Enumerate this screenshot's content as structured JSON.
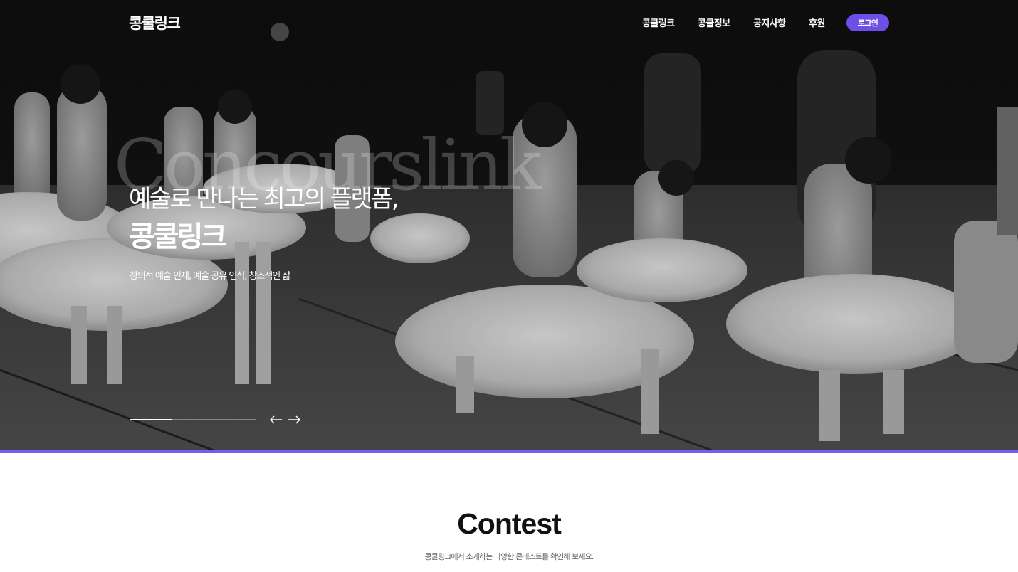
{
  "header": {
    "logo": "콩쿨링크",
    "nav": [
      {
        "label": "콩쿨링크"
      },
      {
        "label": "콩쿨정보"
      },
      {
        "label": "공지사항"
      },
      {
        "label": "후원"
      }
    ],
    "login_label": "로그인"
  },
  "hero": {
    "watermark": "Concourslink",
    "heading_line1": "예술로 만나는 최고의 플랫폼,",
    "heading_line2": "콩쿨링크",
    "subtext": "창의적 예술 인재, 예술 공유 인식, 창조적인 삶",
    "slider_progress": 0.33,
    "prev_icon": "arrow-left-icon",
    "next_icon": "arrow-right-icon"
  },
  "section": {
    "title": "Contest",
    "subtitle": "콩쿨링크에서 소개하는 다양한 콘테스트를 확인해 보세요."
  },
  "colors": {
    "accent": "#6b4fe6",
    "hero_bottom_line": "#7a5af5",
    "hero_bg": "#141414"
  }
}
